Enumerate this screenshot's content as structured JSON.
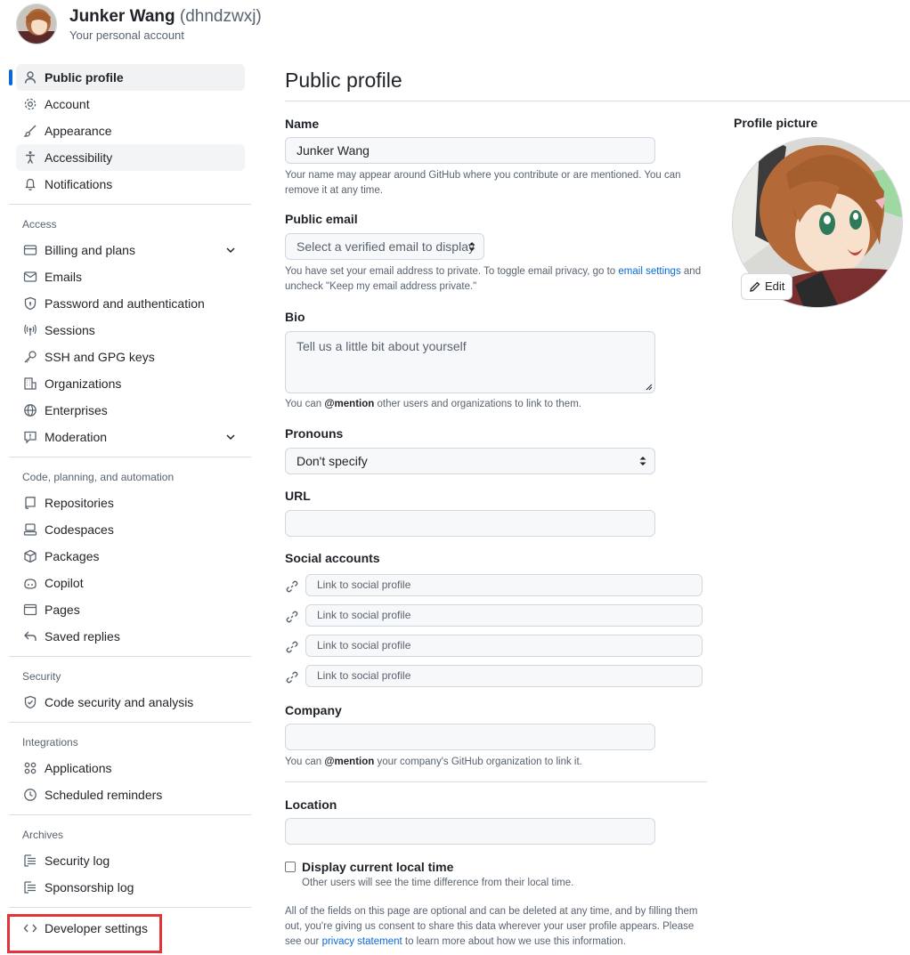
{
  "header": {
    "name": "Junker Wang",
    "login": "(dhndzwxj)",
    "subtitle": "Your personal account"
  },
  "sidebar": {
    "items_top": [
      {
        "label": "Public profile",
        "icon": "person-icon",
        "current": true
      },
      {
        "label": "Account",
        "icon": "gear-icon"
      },
      {
        "label": "Appearance",
        "icon": "paintbrush-icon"
      },
      {
        "label": "Accessibility",
        "icon": "accessibility-icon",
        "hover": true
      },
      {
        "label": "Notifications",
        "icon": "bell-icon"
      }
    ],
    "access_heading": "Access",
    "items_access": [
      {
        "label": "Billing and plans",
        "icon": "credit-card-icon",
        "expandable": true
      },
      {
        "label": "Emails",
        "icon": "mail-icon"
      },
      {
        "label": "Password and authentication",
        "icon": "shield-lock-icon"
      },
      {
        "label": "Sessions",
        "icon": "broadcast-icon"
      },
      {
        "label": "SSH and GPG keys",
        "icon": "key-icon"
      },
      {
        "label": "Organizations",
        "icon": "organization-icon"
      },
      {
        "label": "Enterprises",
        "icon": "globe-icon"
      },
      {
        "label": "Moderation",
        "icon": "report-icon",
        "expandable": true
      }
    ],
    "code_heading": "Code, planning, and automation",
    "items_code": [
      {
        "label": "Repositories",
        "icon": "repo-icon"
      },
      {
        "label": "Codespaces",
        "icon": "codespaces-icon"
      },
      {
        "label": "Packages",
        "icon": "package-icon"
      },
      {
        "label": "Copilot",
        "icon": "copilot-icon"
      },
      {
        "label": "Pages",
        "icon": "browser-icon"
      },
      {
        "label": "Saved replies",
        "icon": "reply-icon"
      }
    ],
    "security_heading": "Security",
    "items_security": [
      {
        "label": "Code security and analysis",
        "icon": "codescan-icon"
      }
    ],
    "integrations_heading": "Integrations",
    "items_integrations": [
      {
        "label": "Applications",
        "icon": "apps-icon"
      },
      {
        "label": "Scheduled reminders",
        "icon": "clock-icon"
      }
    ],
    "archives_heading": "Archives",
    "items_archives": [
      {
        "label": "Security log",
        "icon": "log-icon"
      },
      {
        "label": "Sponsorship log",
        "icon": "log-icon"
      }
    ],
    "developer_settings": "Developer settings"
  },
  "main": {
    "title": "Public profile",
    "name_label": "Name",
    "name_value": "Junker Wang",
    "name_note": "Your name may appear around GitHub where you contribute or are mentioned. You can remove it at any time.",
    "email_label": "Public email",
    "email_select": "Select a verified email to display",
    "email_note_1": "You have set your email address to private. To toggle email privacy, go to ",
    "email_note_link": "email settings",
    "email_note_2": " and uncheck \"Keep my email address private.\"",
    "bio_label": "Bio",
    "bio_placeholder": "Tell us a little bit about yourself",
    "bio_note_1": "You can ",
    "bio_note_mention": "@mention",
    "bio_note_2": " other users and organizations to link to them.",
    "pronouns_label": "Pronouns",
    "pronouns_value": "Don't specify",
    "url_label": "URL",
    "url_value": "",
    "social_label": "Social accounts",
    "social_placeholder": "Link to social profile",
    "company_label": "Company",
    "company_note_1": "You can ",
    "company_note_mention": "@mention",
    "company_note_2": " your company's GitHub organization to link it.",
    "location_label": "Location",
    "local_time_label": "Display current local time",
    "local_time_note": "Other users will see the time difference from their local time.",
    "footer_1": "All of the fields on this page are optional and can be deleted at any time, and by filling them out, you're giving us consent to share this data wherever your user profile appears. Please see our ",
    "footer_link": "privacy statement",
    "footer_2": " to learn more about how we use this information."
  },
  "profile_picture": {
    "label": "Profile picture",
    "edit_label": "Edit"
  },
  "colors": {
    "accent": "#0969da",
    "highlight": "#e5333a"
  }
}
